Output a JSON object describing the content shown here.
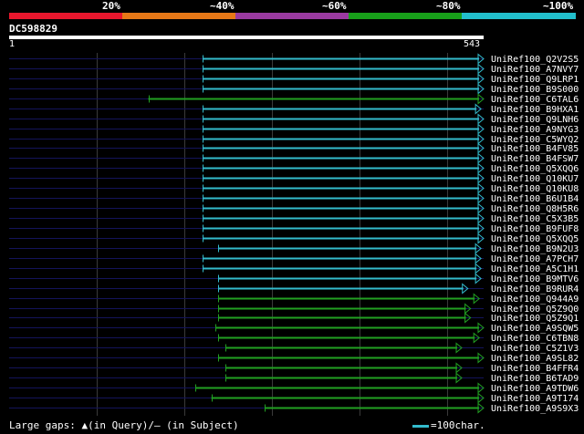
{
  "legend": {
    "percent_labels": [
      "20%",
      "~40%",
      "~60%",
      "~80%",
      "~100%"
    ],
    "colors": [
      "#e8172d",
      "#e77817",
      "#9a3aa0",
      "#18a01a",
      "#22bfcc"
    ]
  },
  "query": {
    "id": "DC598829",
    "start": "1",
    "end": "543",
    "length": 543
  },
  "hits": [
    {
      "name": "UniRef100_Q2V2S5",
      "start": 222,
      "end": 543,
      "identity": 100
    },
    {
      "name": "UniRef100_A7NVY7",
      "start": 222,
      "end": 543,
      "identity": 100
    },
    {
      "name": "UniRef100_Q9LRP1",
      "start": 222,
      "end": 543,
      "identity": 100
    },
    {
      "name": "UniRef100_B9S000",
      "start": 222,
      "end": 543,
      "identity": 100
    },
    {
      "name": "UniRef100_C6TAL6",
      "start": 160,
      "end": 543,
      "identity": 80
    },
    {
      "name": "UniRef100_B9HXA1",
      "start": 222,
      "end": 540,
      "identity": 100
    },
    {
      "name": "UniRef100_Q9LNH6",
      "start": 222,
      "end": 543,
      "identity": 100
    },
    {
      "name": "UniRef100_A9NYG3",
      "start": 222,
      "end": 543,
      "identity": 100
    },
    {
      "name": "UniRef100_C5WYQ2",
      "start": 222,
      "end": 543,
      "identity": 100
    },
    {
      "name": "UniRef100_B4FV85",
      "start": 222,
      "end": 543,
      "identity": 100
    },
    {
      "name": "UniRef100_B4FSW7",
      "start": 222,
      "end": 543,
      "identity": 100
    },
    {
      "name": "UniRef100_Q5XQQ6",
      "start": 222,
      "end": 543,
      "identity": 100
    },
    {
      "name": "UniRef100_Q10KU7",
      "start": 222,
      "end": 543,
      "identity": 100
    },
    {
      "name": "UniRef100_Q10KU8",
      "start": 222,
      "end": 543,
      "identity": 100
    },
    {
      "name": "UniRef100_B6U1B4",
      "start": 222,
      "end": 543,
      "identity": 100
    },
    {
      "name": "UniRef100_Q8H5R6",
      "start": 222,
      "end": 543,
      "identity": 100
    },
    {
      "name": "UniRef100_C5X3B5",
      "start": 222,
      "end": 543,
      "identity": 100
    },
    {
      "name": "UniRef100_B9FUF8",
      "start": 222,
      "end": 543,
      "identity": 100
    },
    {
      "name": "UniRef100_Q5XQQ5",
      "start": 222,
      "end": 543,
      "identity": 100
    },
    {
      "name": "UniRef100_B9N2U3",
      "start": 240,
      "end": 540,
      "identity": 100
    },
    {
      "name": "UniRef100_A7PCH7",
      "start": 222,
      "end": 540,
      "identity": 100
    },
    {
      "name": "UniRef100_A5C1H1",
      "start": 222,
      "end": 540,
      "identity": 100
    },
    {
      "name": "UniRef100_B9MTV6",
      "start": 240,
      "end": 540,
      "identity": 100
    },
    {
      "name": "UniRef100_B9RUR4",
      "start": 240,
      "end": 525,
      "identity": 100
    },
    {
      "name": "UniRef100_Q944A9",
      "start": 240,
      "end": 538,
      "identity": 80
    },
    {
      "name": "UniRef100_Q5Z9Q0",
      "start": 240,
      "end": 528,
      "identity": 80
    },
    {
      "name": "UniRef100_Q5Z9Q1",
      "start": 240,
      "end": 528,
      "identity": 80
    },
    {
      "name": "UniRef100_A9SQW5",
      "start": 237,
      "end": 543,
      "identity": 80
    },
    {
      "name": "UniRef100_C6TBN8",
      "start": 240,
      "end": 538,
      "identity": 80
    },
    {
      "name": "UniRef100_C5Z1V3",
      "start": 248,
      "end": 518,
      "identity": 80
    },
    {
      "name": "UniRef100_A9SL82",
      "start": 240,
      "end": 543,
      "identity": 80
    },
    {
      "name": "UniRef100_B4FFR4",
      "start": 248,
      "end": 518,
      "identity": 80
    },
    {
      "name": "UniRef100_B6TAD9",
      "start": 248,
      "end": 518,
      "identity": 80
    },
    {
      "name": "UniRef100_A9TDW6",
      "start": 214,
      "end": 543,
      "identity": 80
    },
    {
      "name": "UniRef100_A9T174",
      "start": 232,
      "end": 543,
      "identity": 80
    },
    {
      "name": "UniRef100_A9S9X3",
      "start": 293,
      "end": 543,
      "identity": 80
    }
  ],
  "footer": {
    "gap_legend": "Large gaps: ▲(in Query)/– (in Subject)",
    "scale_legend": "=100char."
  }
}
